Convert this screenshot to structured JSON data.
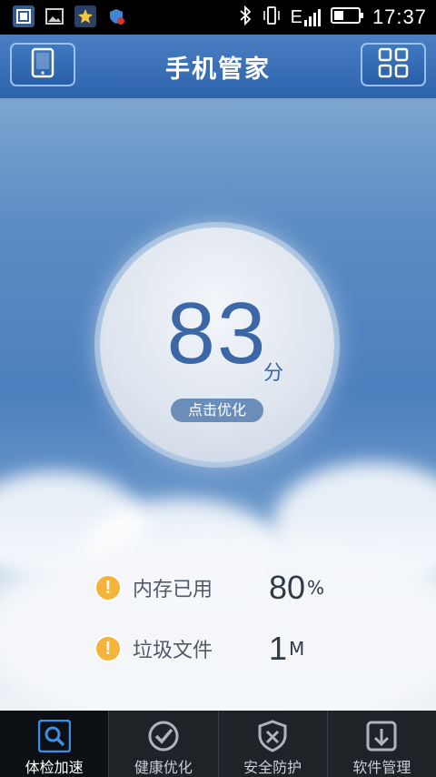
{
  "status_bar": {
    "time": "17:37",
    "network": "E"
  },
  "title_bar": {
    "title": "手机管家"
  },
  "score": {
    "value": "83",
    "unit": "分",
    "action_label": "点击优化"
  },
  "stats": [
    {
      "label": "内存已用",
      "value": "80",
      "unit": "%"
    },
    {
      "label": "垃圾文件",
      "value": "1",
      "unit": "M"
    }
  ],
  "tabs": [
    {
      "label": "体检加速",
      "icon": "magnifier-icon",
      "active": true
    },
    {
      "label": "健康优化",
      "icon": "check-circle-icon",
      "active": false
    },
    {
      "label": "安全防护",
      "icon": "shield-icon",
      "active": false
    },
    {
      "label": "软件管理",
      "icon": "app-manager-icon",
      "active": false
    }
  ],
  "colors": {
    "title_bar": "#2d63ad",
    "score_text": "#3b67a6",
    "warning": "#f4b33a",
    "tab_bar": "#1f2328"
  }
}
